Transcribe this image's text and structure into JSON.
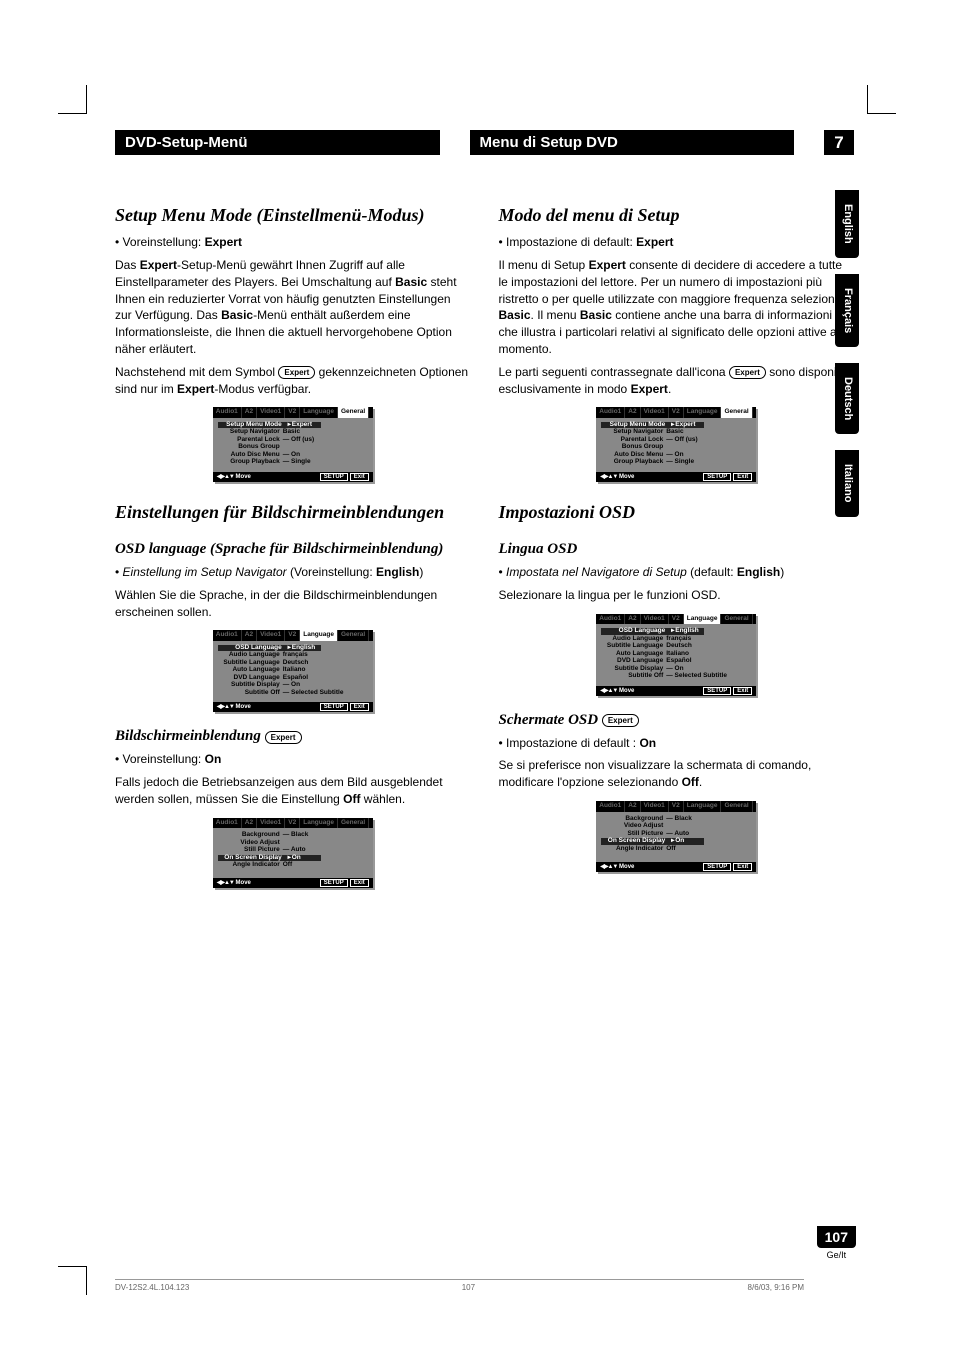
{
  "chapter": {
    "left_title": "DVD-Setup-Menü",
    "right_title": "Menu di Setup DVD",
    "number": "7"
  },
  "left": {
    "h1": "Setup Menu Mode (Einstellmenü-Modus)",
    "preset_label": "Voreinstellung:",
    "preset_value": "Expert",
    "p1a": "Das ",
    "p1b": "-Setup-Menü gewährt Ihnen Zugriff auf alle Einstellparameter des Players. Bei Umschaltung auf ",
    "p1c": " steht Ihnen ein reduzierter Vorrat von häufig genutzten Einstellungen zur Verfügung. Das ",
    "p1d": "-Menü enthält außerdem eine Informationsleiste, die Ihnen die aktuell hervorgehobene Option näher erläutert.",
    "p2a": "Nachstehend mit dem Symbol ",
    "p2b": " gekennzeichneten Optionen sind nur im ",
    "p2c": "-Modus verfügbar.",
    "h2": "Einstellungen für Bildschirmeinblendungen",
    "h3": "OSD language (Sprache für Bildschirmeinblendung)",
    "osd_note_a": "Einstellung im Setup Navigator",
    "osd_note_b": " (Voreinstellung: ",
    "osd_note_c": ")",
    "osd_note_val": "English",
    "osd_p": "Wählen Sie die Sprache, in der die Bildschirmeinblendungen erscheinen sollen.",
    "h4": "Bildschirmeinblendung",
    "bse_preset": "On",
    "bse_p_a": "Falls jedoch die Betriebsanzeigen aus dem Bild ausgeblendet werden sollen, müssen Sie die Einstellung ",
    "bse_p_b": " wählen.",
    "off_word": "Off",
    "basic_word": "Basic",
    "expert_word": "Expert"
  },
  "right": {
    "h1": "Modo del menu di Setup",
    "preset_label": "Impostazione di default:",
    "preset_value": "Expert",
    "p1a": "Il menu di Setup ",
    "p1b": " consente di decidere di accedere a tutte le impostazioni del lettore. Per un numero di impostazioni più ristretto o per quelle utilizzate con maggiore frequenza selezionare ",
    "p1c": ". Il menu ",
    "p1d": " contiene anche una barra di informazioni che illustra i particolari relativi al significato delle opzioni attive al momento.",
    "p2a": "Le parti seguenti contrassegnate dall'icona ",
    "p2b": " sono disponibili esclusivamente in modo ",
    "p2c": ".",
    "h2": "Impostazioni OSD",
    "h3": "Lingua OSD",
    "osd_note_a": "Impostata nel Navigatore di Setup",
    "osd_note_b": " (default: ",
    "osd_note_c": ")",
    "osd_note_val": "English",
    "osd_p": "Selezionare la lingua per le funzioni OSD.",
    "h4": "Schermate OSD",
    "bse_preset_label": "Impostazione di default :",
    "bse_preset": "On",
    "bse_p_a": "Se si preferisce non visualizzare la schermata di comando, modificare l'opzione selezionando ",
    "bse_p_b": ".",
    "off_word": "Off",
    "basic_word": "Basic",
    "expert_word": "Expert"
  },
  "lang_tabs": [
    "English",
    "Français",
    "Deutsch",
    "Italiano"
  ],
  "shot_tabs": [
    "Audio1",
    "A2",
    "Video1",
    "V2",
    "Language",
    "General"
  ],
  "shot1": {
    "active": "General",
    "rows": [
      {
        "l": "Setup Menu Mode",
        "v": "Expert",
        "hi": true,
        "cur": true
      },
      {
        "l": "Setup Navigator",
        "v": "Basic"
      },
      {
        "l": "Parental Lock",
        "v": "— Off (us)"
      },
      {
        "l": "Bonus Group",
        "v": ""
      },
      {
        "l": "Auto Disc Menu",
        "v": "— On"
      },
      {
        "l": "Group Playback",
        "v": "— Single"
      }
    ]
  },
  "shot2": {
    "active": "Language",
    "rows": [
      {
        "l": "OSD Language",
        "v": "English",
        "hi": true,
        "cur": true
      },
      {
        "l": "Audio Language",
        "v": "français"
      },
      {
        "l": "Subtitle Language",
        "v": "Deutsch"
      },
      {
        "l": "Auto Language",
        "v": "Italiano"
      },
      {
        "l": "DVD Language",
        "v": "Español"
      },
      {
        "l": "Subtitle Display",
        "v": "— On"
      },
      {
        "l": "Subtitle Off",
        "v": "— Selected Subtitle"
      }
    ]
  },
  "shot3": {
    "active": "Video2",
    "rows": [
      {
        "l": "Background",
        "v": "— Black"
      },
      {
        "l": "Video Adjust",
        "v": ""
      },
      {
        "l": "Still Picture",
        "v": "— Auto"
      },
      {
        "l": "On Screen Display",
        "v": "On",
        "hi": true,
        "cur": true
      },
      {
        "l": "Angle Indicator",
        "v": "Off"
      }
    ]
  },
  "shot_foot": {
    "move": "Move",
    "setup": "SETUP",
    "exit": "Exit"
  },
  "pagenum": {
    "num": "107",
    "lbl": "Ge/It"
  },
  "footer": {
    "left": "DV-12S2.4L.104.123",
    "mid": "107",
    "right": "8/6/03, 9:16 PM"
  },
  "expert_pill": "Expert"
}
